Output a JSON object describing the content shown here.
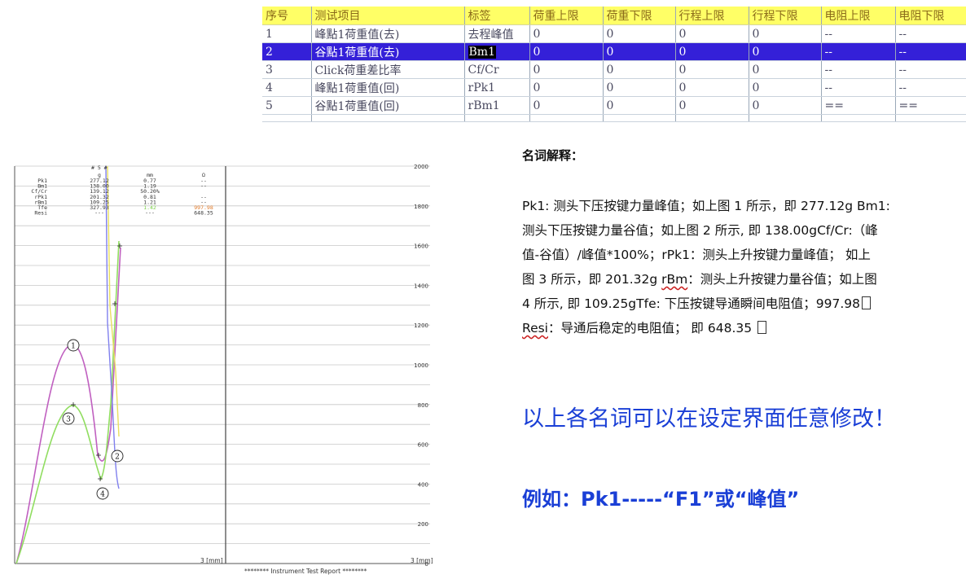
{
  "table": {
    "headers": [
      "序号",
      "测试项目",
      "标签",
      "荷重上限",
      "荷重下限",
      "行程上限",
      "行程下限",
      "电阻上限",
      "电阻下限"
    ],
    "rows": [
      [
        "1",
        "峰點1荷重值(去)",
        "去程峰值",
        "0",
        "0",
        "0",
        "0",
        "--",
        "--"
      ],
      [
        "2",
        "谷點1荷重值(去)",
        "Bm1",
        "0",
        "0",
        "0",
        "0",
        "--",
        "--"
      ],
      [
        "3",
        "Click荷重差比率",
        "Cf/Cr",
        "0",
        "0",
        "0",
        "0",
        "--",
        "--"
      ],
      [
        "4",
        "峰點1荷重值(回)",
        "rPk1",
        "0",
        "0",
        "0",
        "0",
        "--",
        "--"
      ],
      [
        "5",
        "谷點1荷重值(回)",
        "rBm1",
        "0",
        "0",
        "0",
        "0",
        "==",
        "=="
      ]
    ],
    "selected_row": 1
  },
  "chart_data": {
    "type": "line",
    "stats": {
      "header": "# 5 #",
      "units": [
        "g",
        "mm",
        "Ω"
      ],
      "rows": [
        {
          "name": "Pk1",
          "g": "277.12",
          "mm": "0.77",
          "ohm": "--"
        },
        {
          "name": "Bm1",
          "g": "138.00",
          "mm": "1.19",
          "ohm": "--"
        },
        {
          "name": "Cf/Cr",
          "g": "139.12",
          "mm": "50.20%",
          "ohm": ""
        },
        {
          "name": "rPk1",
          "g": "201.32",
          "mm": "0.81",
          "ohm": "--"
        },
        {
          "name": "rBm1",
          "g": "109.25",
          "mm": "1.21",
          "ohm": "--"
        },
        {
          "name": "Tfe",
          "g": "327.93",
          "mm": "1.42",
          "ohm": "997.98"
        },
        {
          "name": "Resi",
          "g": "---",
          "mm": "---",
          "ohm": "648.35"
        }
      ]
    },
    "right_axis_ticks": [
      "2000",
      "1800",
      "1600",
      "1400",
      "1200",
      "1000",
      "800",
      "600",
      "400",
      "200",
      "0"
    ],
    "x_label_left": "3 [mm]",
    "x_label_right": "3 [mm]",
    "footer": "******** Instrument Test Report ********",
    "markers": [
      "1",
      "2",
      "3",
      "4"
    ],
    "colors": {
      "press": "#c060c0",
      "release": "#90dd60",
      "resistance": "#e8e060",
      "resistance_drop": "#8080ee",
      "grid": "#c8c8c8"
    }
  },
  "explanation": {
    "title": "名词解释：",
    "lines": [
      "Pk1: 测头下压按键力量峰值；如上图 1 所示，即 277.12g Bm1:",
      "测头下压按键力量谷值；如上图 2 所示, 即 138.00gCf/Cr:（峰",
      "值-谷值）/峰值*100%；rPk1：测头上升按键力量峰值；  如上",
      "图 3 所示，即 201.32g   ",
      "：测头上升按键力量谷值；如上图",
      "4 所示, 即 109.25gTfe:   下压按键导通瞬间电阻值；997.98",
      "：导通后稳定的电阻值；  即 648.35 "
    ],
    "rbm": "rBm",
    "resi": "Resi",
    "note1": "以上各名词可以在设定界面任意修改！",
    "note2": "例如：Pk1-----“F1”或“峰值”"
  }
}
